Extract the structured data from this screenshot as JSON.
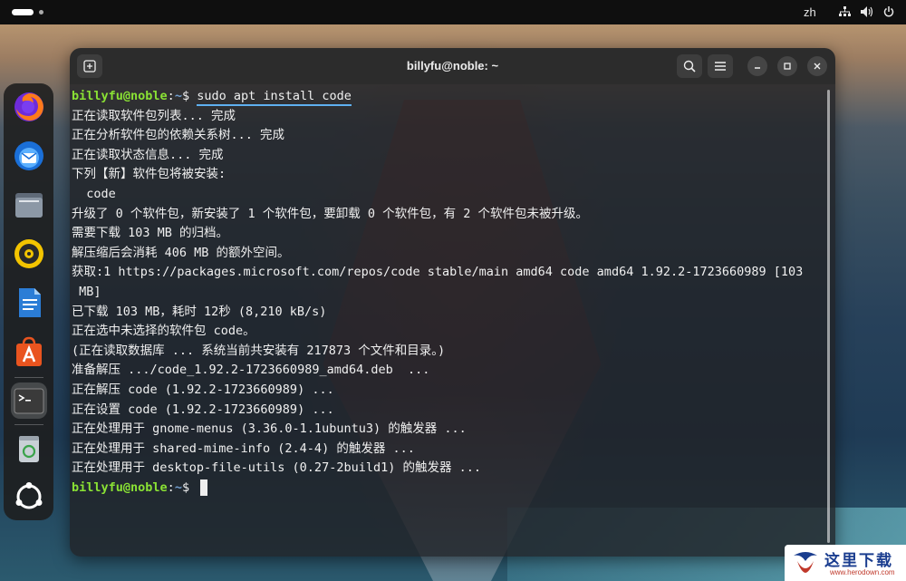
{
  "topbar": {
    "language": "zh"
  },
  "window": {
    "title": "billyfu@noble: ~"
  },
  "terminal": {
    "prompt_user": "billyfu@noble",
    "prompt_sep": ":",
    "prompt_path": "~",
    "prompt_symbol": "$ ",
    "command": "sudo apt install code",
    "output": [
      "正在读取软件包列表... 完成",
      "正在分析软件包的依赖关系树... 完成",
      "正在读取状态信息... 完成",
      "下列【新】软件包将被安装:",
      "  code",
      "升级了 0 个软件包，新安装了 1 个软件包，要卸载 0 个软件包，有 2 个软件包未被升级。",
      "需要下载 103 MB 的归档。",
      "解压缩后会消耗 406 MB 的额外空间。",
      "获取:1 https://packages.microsoft.com/repos/code stable/main amd64 code amd64 1.92.2-1723660989 [103",
      " MB]",
      "已下载 103 MB，耗时 12秒 (8,210 kB/s)",
      "正在选中未选择的软件包 code。",
      "(正在读取数据库 ... 系统当前共安装有 217873 个文件和目录。)",
      "准备解压 .../code_1.92.2-1723660989_amd64.deb  ...",
      "正在解压 code (1.92.2-1723660989) ...",
      "正在设置 code (1.92.2-1723660989) ...",
      "正在处理用于 gnome-menus (3.36.0-1.1ubuntu3) 的触发器 ...",
      "正在处理用于 shared-mime-info (2.4-4) 的触发器 ...",
      "正在处理用于 desktop-file-utils (0.27-2build1) 的触发器 ..."
    ]
  },
  "dock": {
    "items": [
      {
        "icon": "firefox-icon",
        "active": false
      },
      {
        "icon": "thunderbird-icon",
        "active": false
      },
      {
        "icon": "files-icon",
        "active": false
      },
      {
        "icon": "rhythmbox-icon",
        "active": false
      },
      {
        "icon": "libreoffice-writer-icon",
        "active": false
      },
      {
        "icon": "app-center-icon",
        "active": false
      },
      {
        "icon": "terminal-icon",
        "active": true
      },
      {
        "icon": "trash-icon",
        "active": false
      },
      {
        "icon": "show-apps-icon",
        "active": false
      }
    ]
  },
  "watermark": {
    "text": "这里下载",
    "sub": "www.herodown.com"
  },
  "colors": {
    "prompt_user": "#8ae234",
    "prompt_path": "#729fcf",
    "titlebar": "#2c2c2c",
    "command_underline": "#5fb0f0"
  }
}
